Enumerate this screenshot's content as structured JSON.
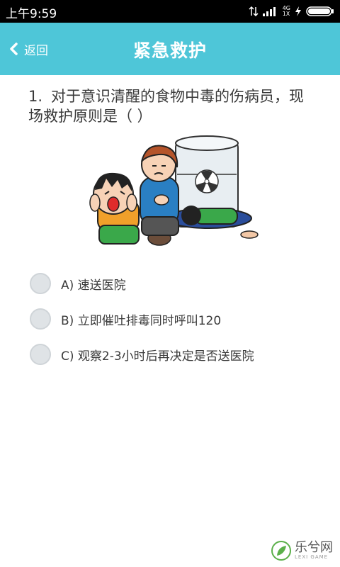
{
  "status_bar": {
    "time": "上午9:59",
    "network": "4G",
    "network2": "1X"
  },
  "app_bar": {
    "back_label": "返回",
    "title": "紧急救护"
  },
  "question": {
    "number": "1.",
    "text": "对于意识清醒的食物中毒的伤病员，现场救护原则是（  ）"
  },
  "options": [
    {
      "label": "A) 速送医院"
    },
    {
      "label": "B) 立即催吐排毒同时呼叫120"
    },
    {
      "label": "C) 观察2-3小时后再决定是否送医院"
    }
  ],
  "watermark": {
    "text": "乐兮网",
    "sub": "LEXI GAME"
  },
  "colors": {
    "appbar": "#4ec6d8",
    "statusbar": "#000000"
  }
}
